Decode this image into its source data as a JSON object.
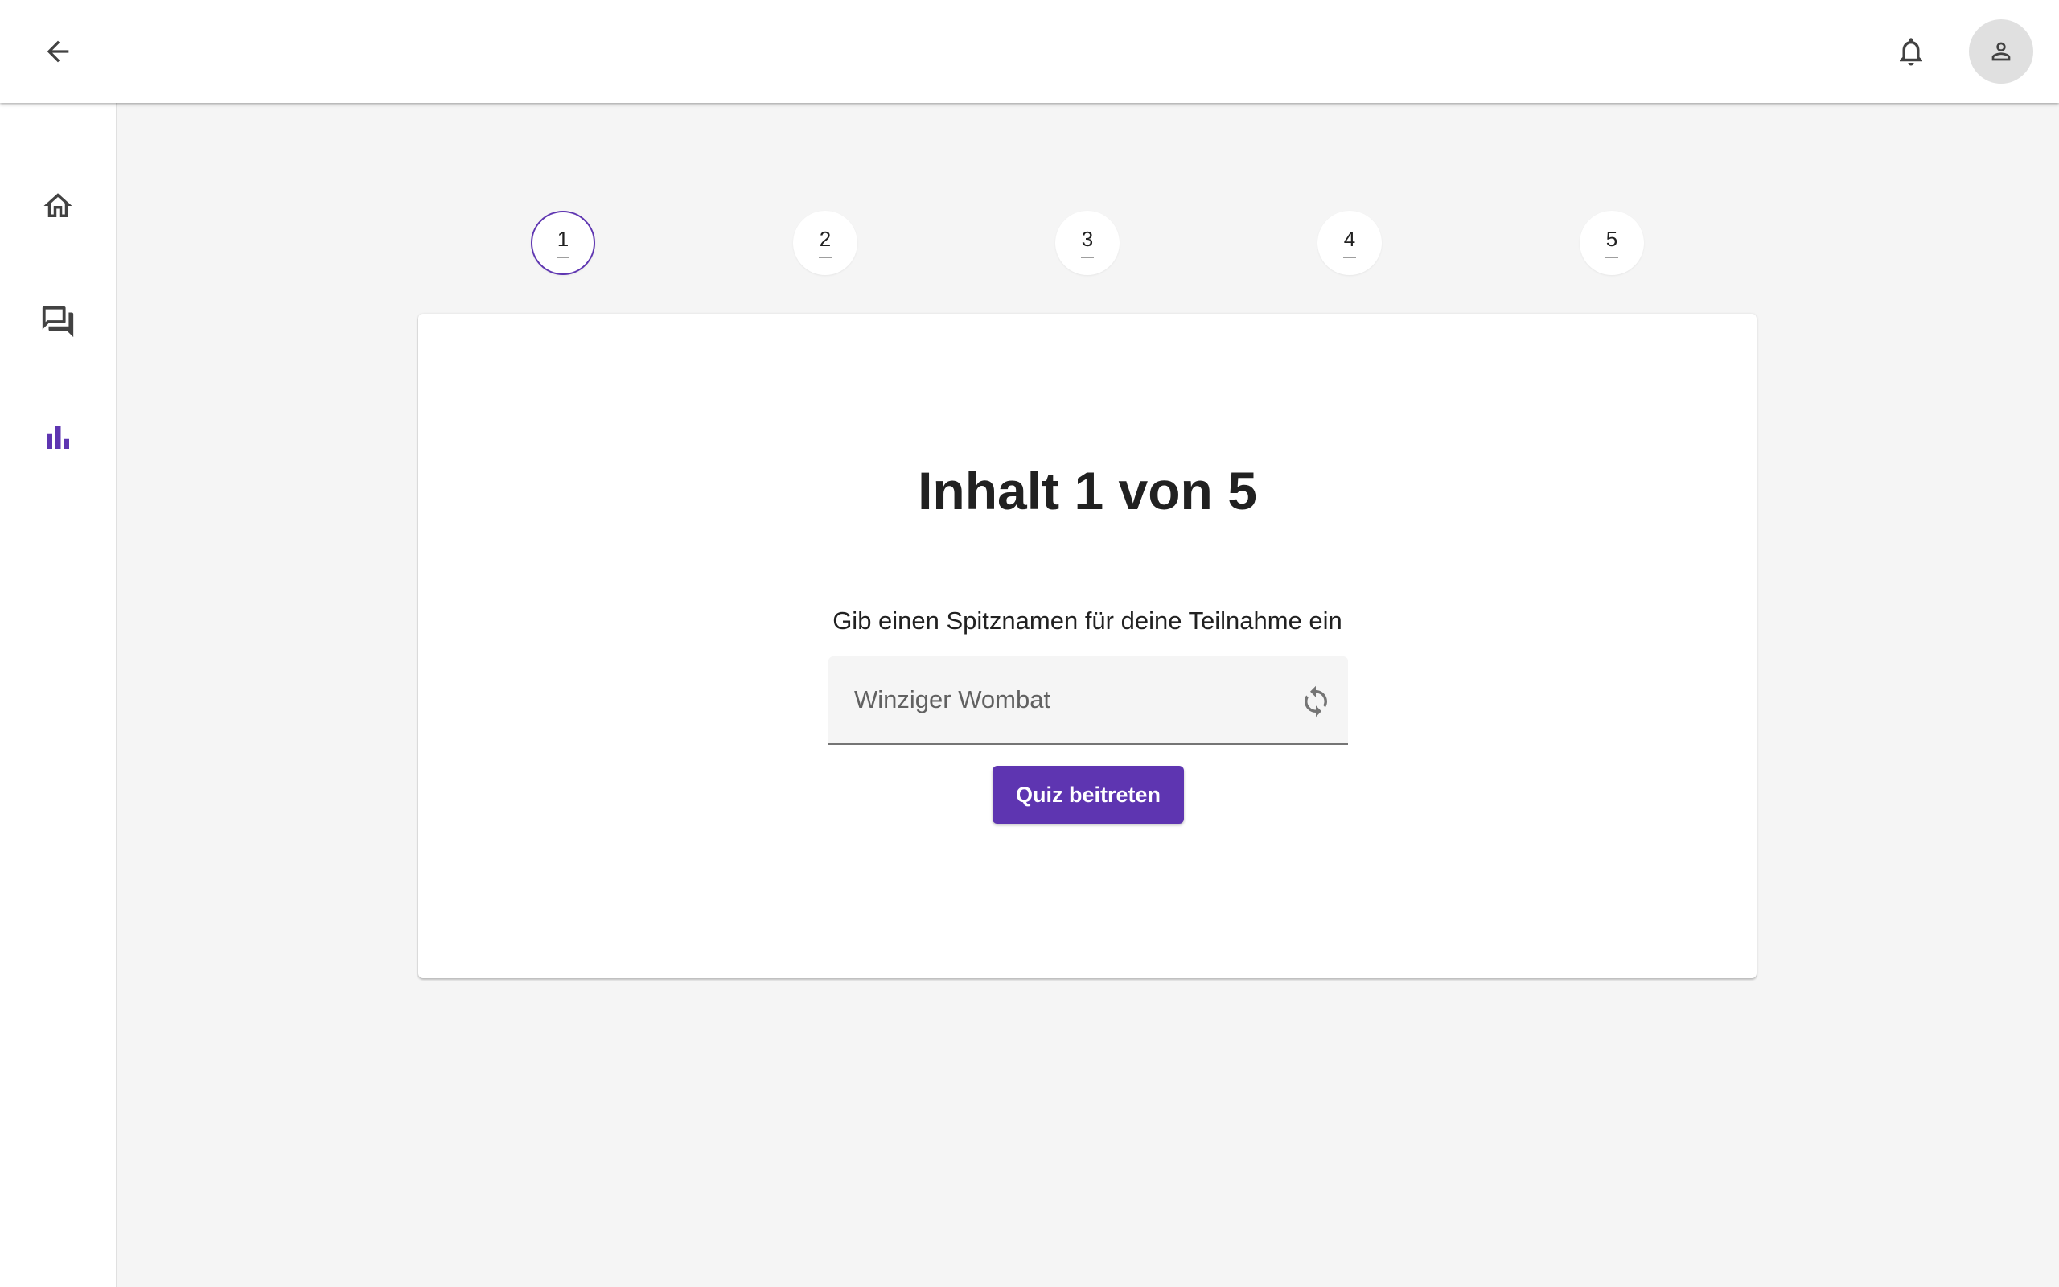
{
  "header": {
    "back_icon": "arrow-back-icon",
    "notifications_icon": "bell-icon",
    "account_icon": "person-icon"
  },
  "sidebar": {
    "items": [
      {
        "icon": "home-icon",
        "active": false
      },
      {
        "icon": "forum-icon",
        "active": false
      },
      {
        "icon": "bar-chart-icon",
        "active": true
      }
    ]
  },
  "stepper": {
    "steps": [
      {
        "number": "1",
        "active": true
      },
      {
        "number": "2",
        "active": false
      },
      {
        "number": "3",
        "active": false
      },
      {
        "number": "4",
        "active": false
      },
      {
        "number": "5",
        "active": false
      }
    ]
  },
  "card": {
    "title_prefix": "Inhalt",
    "current": "1",
    "title_mid": "von",
    "total": "5",
    "prompt": "Gib einen Spitznamen für deine Teilnahme ein",
    "nickname_value": "Winziger Wombat",
    "refresh_icon": "refresh-icon",
    "join_label": "Quiz beitreten"
  },
  "colors": {
    "accent": "#5e35b1",
    "background": "#f5f5f5",
    "surface": "#ffffff"
  }
}
